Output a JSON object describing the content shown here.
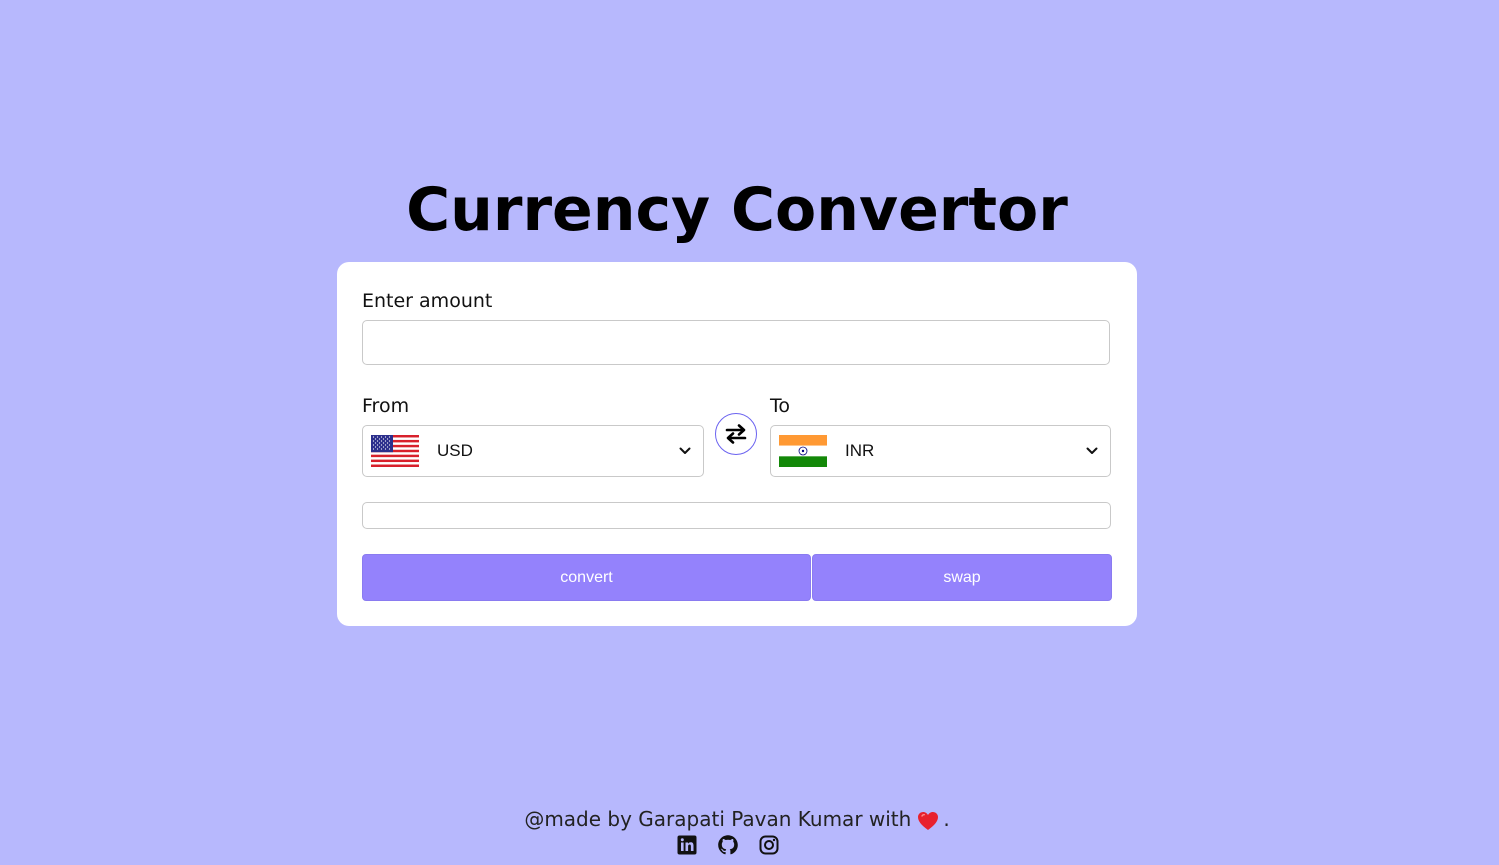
{
  "page": {
    "title": "Currency Convertor"
  },
  "form": {
    "amount_label": "Enter amount",
    "amount_value": "",
    "from_label": "From",
    "to_label": "To",
    "from_currency": "USD",
    "to_currency": "INR",
    "from_flag": "us-flag-icon",
    "to_flag": "india-flag-icon",
    "result_value": ""
  },
  "buttons": {
    "convert_label": "convert",
    "swap_label": "swap",
    "swap_icon": "swap-arrows-icon"
  },
  "footer": {
    "text": "@made by Garapati Pavan Kumar with",
    "heart_icon": "heart-icon",
    "period": ".",
    "social_icons": [
      "linkedin-icon",
      "github-icon",
      "instagram-icon"
    ]
  },
  "colors": {
    "background": "#b7b8fd",
    "card": "#ffffff",
    "button": "#9482fc",
    "swap_border": "#6b63f0",
    "heart": "#e8212e"
  }
}
